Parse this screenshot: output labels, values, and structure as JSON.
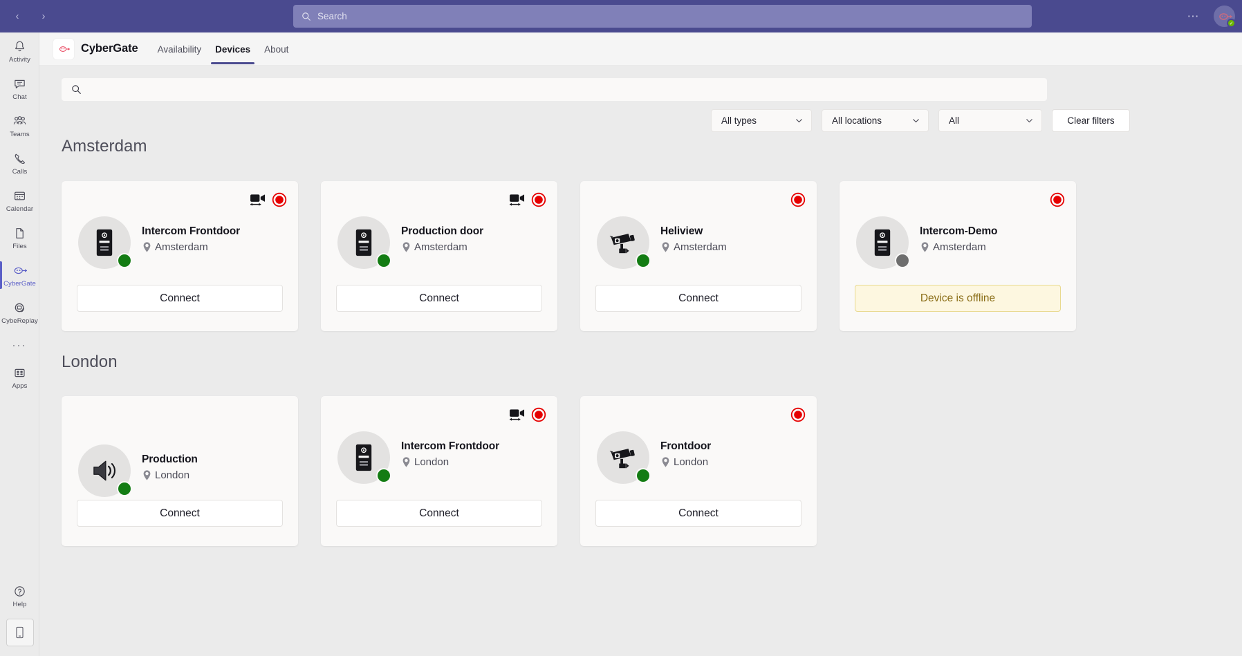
{
  "topbar": {
    "back_label": "‹",
    "forward_label": "›",
    "search_placeholder": "Search",
    "more_label": "⋯"
  },
  "rail": {
    "items": [
      {
        "label": "Activity",
        "icon": "bell-icon",
        "active": false
      },
      {
        "label": "Chat",
        "icon": "chat-icon",
        "active": false
      },
      {
        "label": "Teams",
        "icon": "teams-icon",
        "active": false
      },
      {
        "label": "Calls",
        "icon": "phone-icon",
        "active": false
      },
      {
        "label": "Calendar",
        "icon": "calendar-icon",
        "active": false
      },
      {
        "label": "Files",
        "icon": "file-icon",
        "active": false
      },
      {
        "label": "CyberGate",
        "icon": "cybergate-icon",
        "active": true
      },
      {
        "label": "CybeReplay",
        "icon": "cybereplay-icon",
        "active": false
      }
    ],
    "more_label": "···",
    "apps_label": "Apps",
    "help_label": "Help"
  },
  "app_header": {
    "title": "CyberGate",
    "tabs": [
      {
        "label": "Availability",
        "active": false
      },
      {
        "label": "Devices",
        "active": true
      },
      {
        "label": "About",
        "active": false
      }
    ]
  },
  "toolbar": {
    "search_value": "",
    "search_placeholder": "",
    "filters": [
      {
        "name": "type-filter",
        "value": "All types"
      },
      {
        "name": "location-filter",
        "value": "All locations"
      },
      {
        "name": "status-filter",
        "value": "All"
      }
    ],
    "clear_filters_label": "Clear filters"
  },
  "sections": [
    {
      "title": "Amsterdam",
      "cards": [
        {
          "name": "Intercom Frontdoor",
          "location": "Amsterdam",
          "device_icon": "intercom-icon",
          "status": "online",
          "has_video_badge": true,
          "has_record_badge": true,
          "action_label": "Connect",
          "action_state": "connect"
        },
        {
          "name": "Production door",
          "location": "Amsterdam",
          "device_icon": "intercom-icon",
          "status": "online",
          "has_video_badge": true,
          "has_record_badge": true,
          "action_label": "Connect",
          "action_state": "connect"
        },
        {
          "name": "Heliview",
          "location": "Amsterdam",
          "device_icon": "cctv-camera-icon",
          "status": "online",
          "has_video_badge": false,
          "has_record_badge": true,
          "action_label": "Connect",
          "action_state": "connect"
        },
        {
          "name": "Intercom-Demo",
          "location": "Amsterdam",
          "device_icon": "intercom-icon",
          "status": "offline",
          "has_video_badge": false,
          "has_record_badge": true,
          "action_label": "Device is offline",
          "action_state": "offline"
        }
      ]
    },
    {
      "title": "London",
      "cards": [
        {
          "name": "Production",
          "location": "London",
          "device_icon": "speaker-icon",
          "status": "online",
          "has_video_badge": false,
          "has_record_badge": false,
          "action_label": "Connect",
          "action_state": "connect"
        },
        {
          "name": "Intercom Frontdoor",
          "location": "London",
          "device_icon": "intercom-icon",
          "status": "online",
          "has_video_badge": true,
          "has_record_badge": true,
          "action_label": "Connect",
          "action_state": "connect"
        },
        {
          "name": "Frontdoor",
          "location": "London",
          "device_icon": "cctv-camera-icon",
          "status": "online",
          "has_video_badge": false,
          "has_record_badge": true,
          "action_label": "Connect",
          "action_state": "connect"
        }
      ]
    }
  ],
  "colors": {
    "teams_purple": "#4a4a8f",
    "accent": "#5b5fc7",
    "online": "#137c13",
    "offline": "#6e6e6e",
    "record_red": "#e60000",
    "offline_banner_bg": "#fdf7e0",
    "offline_banner_text": "#8a6d16"
  }
}
